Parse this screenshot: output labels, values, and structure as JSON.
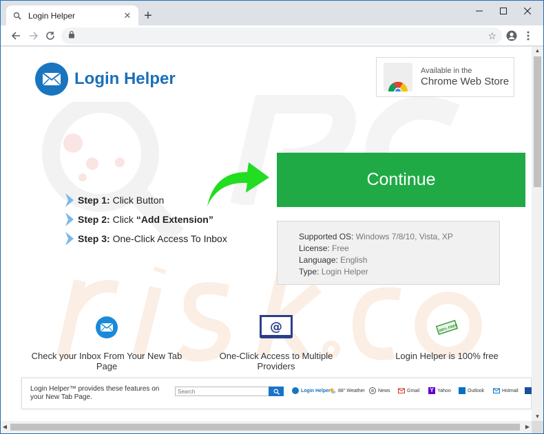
{
  "browser": {
    "tab_title": "Login Helper",
    "tab_close_icon": "close-icon",
    "new_tab_icon": "plus-icon",
    "address_value": "",
    "window_controls": [
      "minimize-icon",
      "maximize-icon",
      "close-icon"
    ]
  },
  "header": {
    "brand_name": "Login Helper",
    "store_badge": {
      "line1": "Available in the",
      "line2": "Chrome Web Store"
    }
  },
  "cta": {
    "continue_label": "Continue",
    "arrow_color": "#22dd22"
  },
  "steps": [
    {
      "prefix": "Step 1:",
      "text": " Click Button",
      "bold_text": ""
    },
    {
      "prefix": "Step 2:",
      "text": " Click ",
      "bold_text": "“Add Extension”"
    },
    {
      "prefix": "Step 3:",
      "text": " One-Click Access To Inbox",
      "bold_text": ""
    }
  ],
  "info": {
    "os_label": "Supported OS:",
    "os_value": " Windows 7/8/10, Vista, XP",
    "license_label": "License:",
    "license_value": " Free",
    "language_label": "Language:",
    "language_value": " English",
    "type_label": "Type:",
    "type_value": " Login Helper"
  },
  "features": [
    {
      "icon": "envelope-circle-icon",
      "label": "Check your Inbox From Your New Tab Page"
    },
    {
      "icon": "at-sign-monitor-icon",
      "label": "One-Click Access to Multiple Providers"
    },
    {
      "icon": "free-stamp-icon",
      "label": "Login Helper is 100% free",
      "stamp_text": "100% FREE"
    }
  ],
  "preview": {
    "description": "Login Helper™ provides these features on your New Tab Page.",
    "search_placeholder": "Search",
    "links": {
      "brand": "Login Helper",
      "weather": "88° Weather",
      "news": "News",
      "gmail": "Gmail",
      "yahoo": "Yahoo",
      "outlook": "Outlook",
      "hotmail": "Hotmail"
    }
  },
  "colors": {
    "brand_blue": "#1a6fb8",
    "continue_green": "#1faa45"
  }
}
